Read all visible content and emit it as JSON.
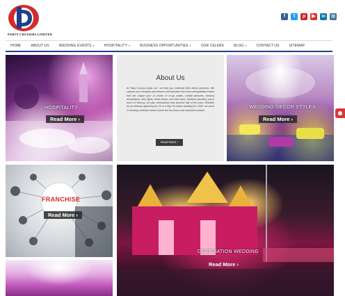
{
  "brand": {
    "tagline": "PARTY CRUISERS LIMITED",
    "colors": {
      "red": "#d42a2a",
      "blue": "#1f3f8a"
    }
  },
  "social": [
    {
      "icon": "facebook-icon",
      "glyph": "f",
      "color": "#3b5998"
    },
    {
      "icon": "twitter-icon",
      "glyph": "t",
      "color": "#1da1f2"
    },
    {
      "icon": "pinterest-icon",
      "glyph": "p",
      "color": "#cb2027"
    },
    {
      "icon": "youtube-icon",
      "glyph": "▶",
      "color": "#e52d27"
    },
    {
      "icon": "linkedin-icon",
      "glyph": "in",
      "color": "#0e76a8"
    },
    {
      "icon": "instagram-icon",
      "glyph": "◎",
      "color": "#3f729b"
    }
  ],
  "nav": {
    "items": [
      {
        "label": "HOME",
        "caret": ""
      },
      {
        "label": "ABOUT US",
        "caret": ""
      },
      {
        "label": "WEDDING EVENTS",
        "caret": "▾"
      },
      {
        "label": "HOSPITALITY",
        "caret": "▾"
      },
      {
        "label": "BUSINESS OPPORTUNITIES",
        "caret": "▾"
      },
      {
        "label": "OUR CELEBS",
        "caret": ""
      },
      {
        "label": "BLOG",
        "caret": "▾"
      },
      {
        "label": "CONTACT US",
        "caret": ""
      },
      {
        "label": "SITEMAP",
        "caret": ""
      }
    ]
  },
  "tiles": {
    "hospitality": {
      "caption": "HOSPITALITY",
      "cta": "Read More ›"
    },
    "about": {
      "title": "About Us",
      "text": "At Party Cruisers India Ltd , we help you celebrate life's finest moments. We capture your thoughts and dreams and translate them into unforgettable events that are unique your Ju lovers of th-up smiles, candid gestures, dreamy destinations, fairy lights, fresh florals, rich-vivid eyes, heirloom jewellery and a touch of whimsy, we plan celebrations that become talk of the town. Whether it's an intimate gathering for 25 or a Big Fat Indian wedding for 1500, we excel in creating cohesive events where the fun floors and memories endure.",
      "cta": "Read More ›"
    },
    "wedding_decor": {
      "caption": "WEDDING DECOR STYLES",
      "cta": "Read More ›"
    },
    "franchise": {
      "caption": "FRANCHISE",
      "cta": "Read More ›"
    },
    "destination": {
      "caption": "DESTINATION WEDDING",
      "cta": "Read More ›"
    }
  }
}
